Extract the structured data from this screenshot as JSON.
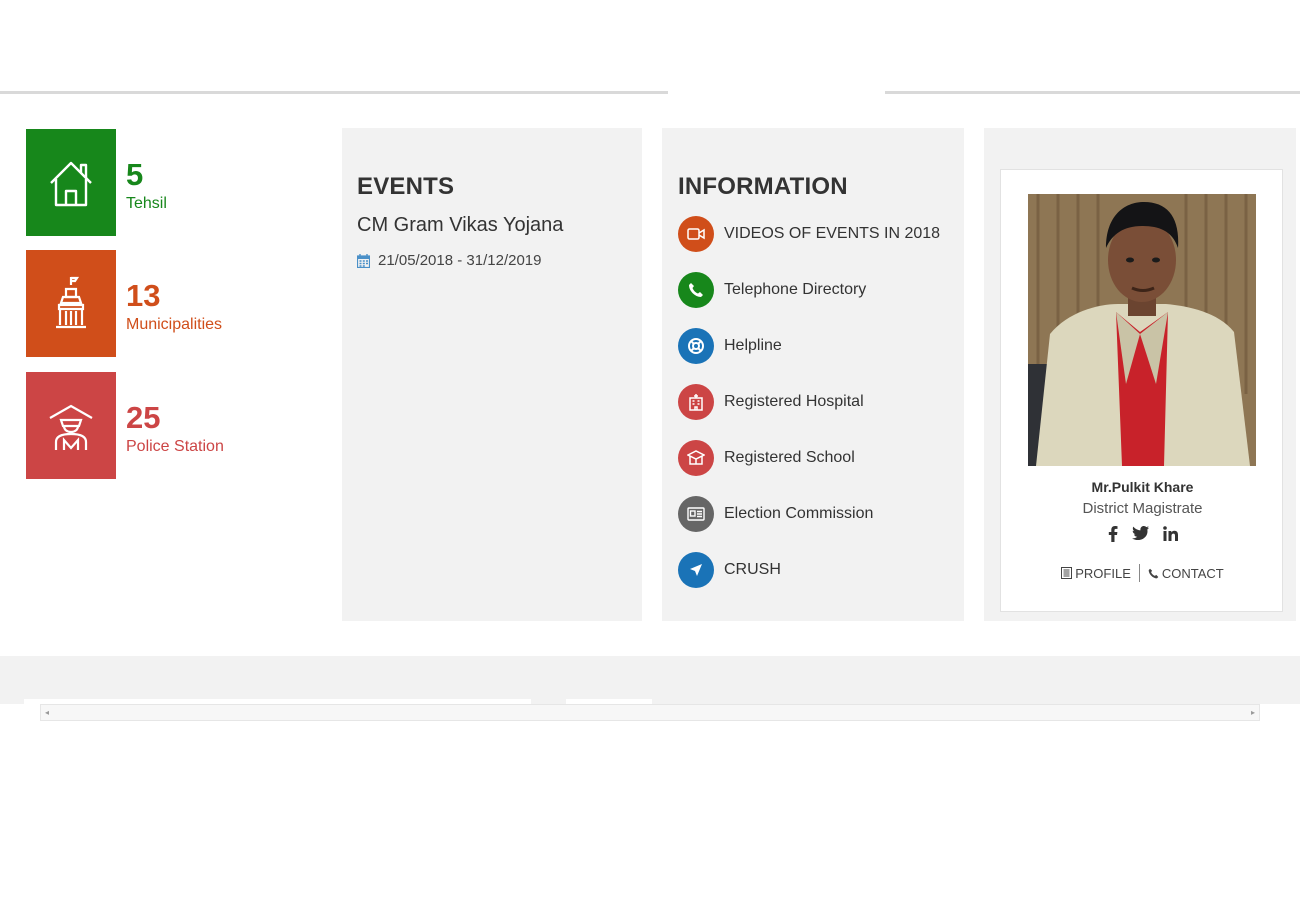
{
  "stats": [
    {
      "value": "5",
      "label": "Tehsil",
      "color": "#17871b",
      "icon": "house-icon"
    },
    {
      "value": "13",
      "label": "Municipalities",
      "color": "#d04e1a",
      "icon": "municipal-building-icon"
    },
    {
      "value": "25",
      "label": "Police Station",
      "color": "#cc4545",
      "icon": "police-officer-icon"
    }
  ],
  "events": {
    "heading": "EVENTS",
    "title": "CM Gram Vikas Yojana",
    "date": "21/05/2018 - 31/12/2019",
    "icon": "calendar-icon"
  },
  "information": {
    "heading": "INFORMATION",
    "items": [
      {
        "label": "VIDEOS OF EVENTS IN 2018",
        "color": "#d04e1a",
        "icon": "video-icon"
      },
      {
        "label": "Telephone Directory",
        "color": "#17871b",
        "icon": "phone-icon"
      },
      {
        "label": "Helpline",
        "color": "#1a73b7",
        "icon": "lifebuoy-icon"
      },
      {
        "label": "Registered Hospital",
        "color": "#cc4545",
        "icon": "hospital-icon"
      },
      {
        "label": "Registered School",
        "color": "#cc4545",
        "icon": "school-icon"
      },
      {
        "label": "Election Commission",
        "color": "#666666",
        "icon": "id-card-icon"
      },
      {
        "label": "CRUSH",
        "color": "#1a73b7",
        "icon": "location-arrow-icon"
      }
    ]
  },
  "officer": {
    "name": "Mr.Pulkit Khare",
    "designation": "District Magistrate",
    "social": [
      "facebook-icon",
      "twitter-icon",
      "linkedin-icon"
    ],
    "profile_label": "PROFILE",
    "contact_label": "CONTACT"
  }
}
